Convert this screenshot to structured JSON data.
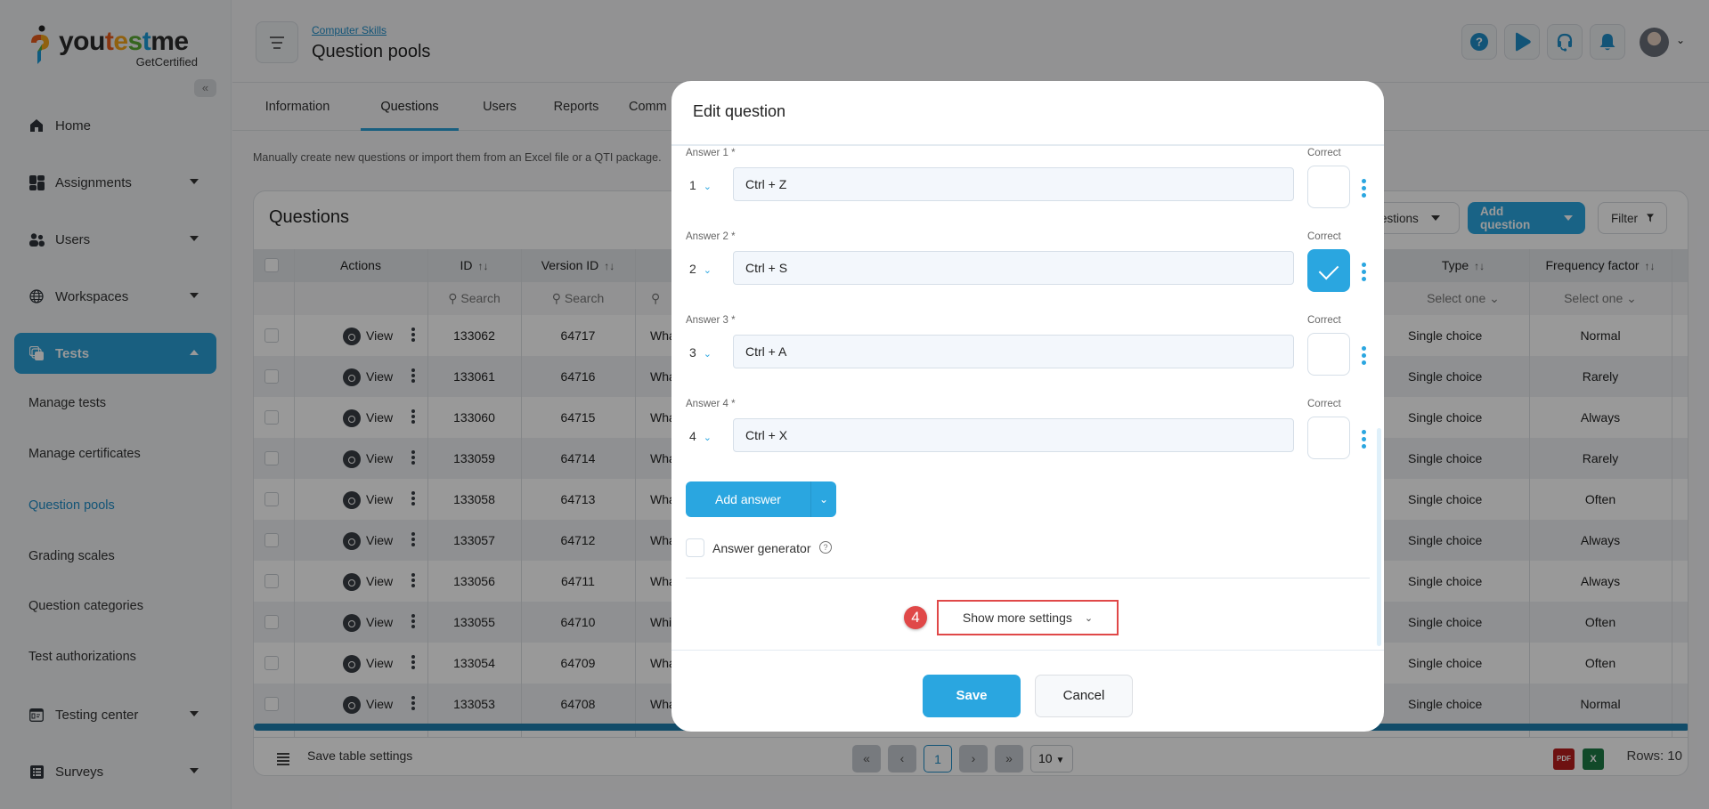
{
  "brand": {
    "name_parts": [
      "you",
      "t",
      "e",
      "s",
      "t",
      "me"
    ],
    "tagline": "GetCertified"
  },
  "sidebar": {
    "collapse_icon": "double-chevron-left",
    "items": [
      {
        "label": "Home",
        "icon": "home-icon"
      },
      {
        "label": "Assignments",
        "icon": "dashboard-icon"
      },
      {
        "label": "Users",
        "icon": "users-icon"
      },
      {
        "label": "Workspaces",
        "icon": "globe-icon"
      },
      {
        "label": "Tests",
        "icon": "stack-icon",
        "active": true
      },
      {
        "label": "Testing center",
        "icon": "calendar-icon"
      },
      {
        "label": "Surveys",
        "icon": "list-icon"
      }
    ],
    "sub_items": [
      "Manage tests",
      "Manage certificates",
      "Question pools",
      "Grading scales",
      "Question categories",
      "Test authorizations"
    ],
    "current_sub": "Question pools"
  },
  "header": {
    "breadcrumb": "Computer Skills",
    "title": "Question pools",
    "icons": [
      "help-icon",
      "play-icon",
      "headset-icon",
      "bell-icon"
    ]
  },
  "tabs": [
    "Information",
    "Questions",
    "Users",
    "Reports",
    "Comm"
  ],
  "active_tab": "Questions",
  "hint": "Manually create new questions or import them from an Excel file or a QTI package.",
  "table": {
    "title": "Questions",
    "toolbar": {
      "import_label": "estions",
      "add_label": "Add question",
      "filter_label": "Filter"
    },
    "columns": [
      "Actions",
      "ID",
      "Version ID",
      "Type",
      "Frequency factor"
    ],
    "search_placeholder": "Search",
    "select_placeholder": "Select one",
    "view_label": "View",
    "rows": [
      {
        "id": "133062",
        "version": "64717",
        "text": "Wha",
        "type": "Single choice",
        "freq": "Normal"
      },
      {
        "id": "133061",
        "version": "64716",
        "text": "Wha",
        "type": "Single choice",
        "freq": "Rarely"
      },
      {
        "id": "133060",
        "version": "64715",
        "text": "Wha",
        "type": "Single choice",
        "freq": "Always"
      },
      {
        "id": "133059",
        "version": "64714",
        "text": "Wha",
        "type": "Single choice",
        "freq": "Rarely"
      },
      {
        "id": "133058",
        "version": "64713",
        "text": "Wha",
        "type": "Single choice",
        "freq": "Often"
      },
      {
        "id": "133057",
        "version": "64712",
        "text": "Wha",
        "type": "Single choice",
        "freq": "Always"
      },
      {
        "id": "133056",
        "version": "64711",
        "text": "Wha",
        "type": "Single choice",
        "freq": "Always"
      },
      {
        "id": "133055",
        "version": "64710",
        "text": "Whi",
        "type": "Single choice",
        "freq": "Often"
      },
      {
        "id": "133054",
        "version": "64709",
        "text": "Wha",
        "type": "Single choice",
        "freq": "Often"
      },
      {
        "id": "133053",
        "version": "64708",
        "text": "Wha",
        "type": "Single choice",
        "freq": "Normal"
      }
    ],
    "footer": {
      "save_settings": "Save table settings",
      "page": "1",
      "page_size": "10",
      "rows_label": "Rows: 10",
      "pdf_label": "PDF",
      "excel_label": "X"
    }
  },
  "modal": {
    "title": "Edit question",
    "correct_label": "Correct",
    "answers": [
      {
        "label": "Answer 1 *",
        "order": "1",
        "value": "Ctrl + Z",
        "correct": false
      },
      {
        "label": "Answer 2 *",
        "order": "2",
        "value": "Ctrl + S",
        "correct": true
      },
      {
        "label": "Answer 3 *",
        "order": "3",
        "value": "Ctrl + A",
        "correct": false
      },
      {
        "label": "Answer 4 *",
        "order": "4",
        "value": "Ctrl + X",
        "correct": false
      }
    ],
    "add_answer_label": "Add answer",
    "answer_generator_label": "Answer generator",
    "step_number": "4",
    "show_more_label": "Show more settings",
    "save_label": "Save",
    "cancel_label": "Cancel"
  },
  "colors": {
    "accent": "#2aa6e0",
    "highlight": "#e04848",
    "active_nav": "#2a9fd6"
  }
}
